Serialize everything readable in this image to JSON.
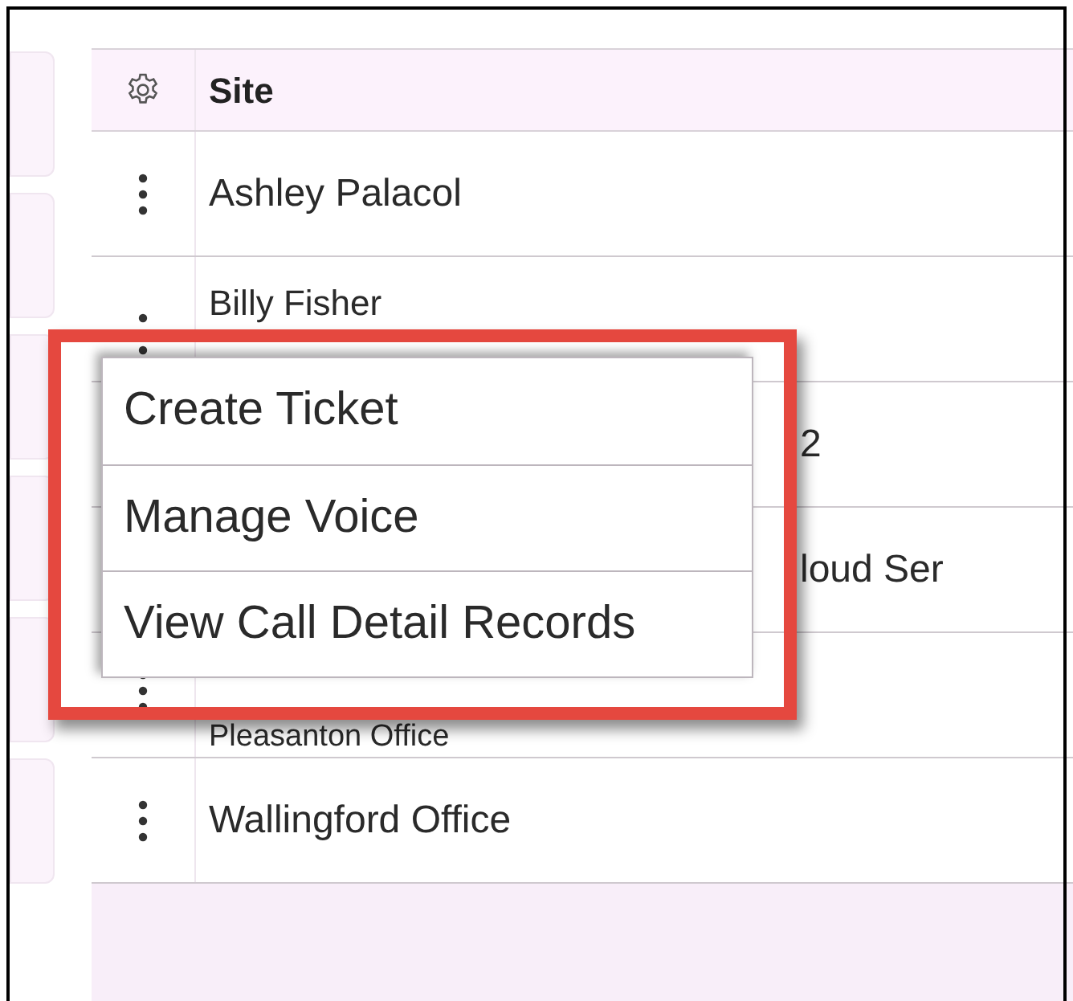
{
  "table": {
    "columns": [
      {
        "label": "Site"
      }
    ],
    "rows": [
      {
        "kind": "full",
        "site": "Ashley Palacol"
      },
      {
        "kind": "top",
        "site": "Billy Fisher"
      },
      {
        "kind": "clipped",
        "site": "2"
      },
      {
        "kind": "clipped",
        "site": "loud Ser"
      },
      {
        "kind": "bottom",
        "site": "Pleasanton Office"
      },
      {
        "kind": "full",
        "site": "Wallingford Office"
      }
    ]
  },
  "context_menu": {
    "items": [
      "Create Ticket",
      "Manage Voice",
      "View Call Detail Records"
    ]
  }
}
